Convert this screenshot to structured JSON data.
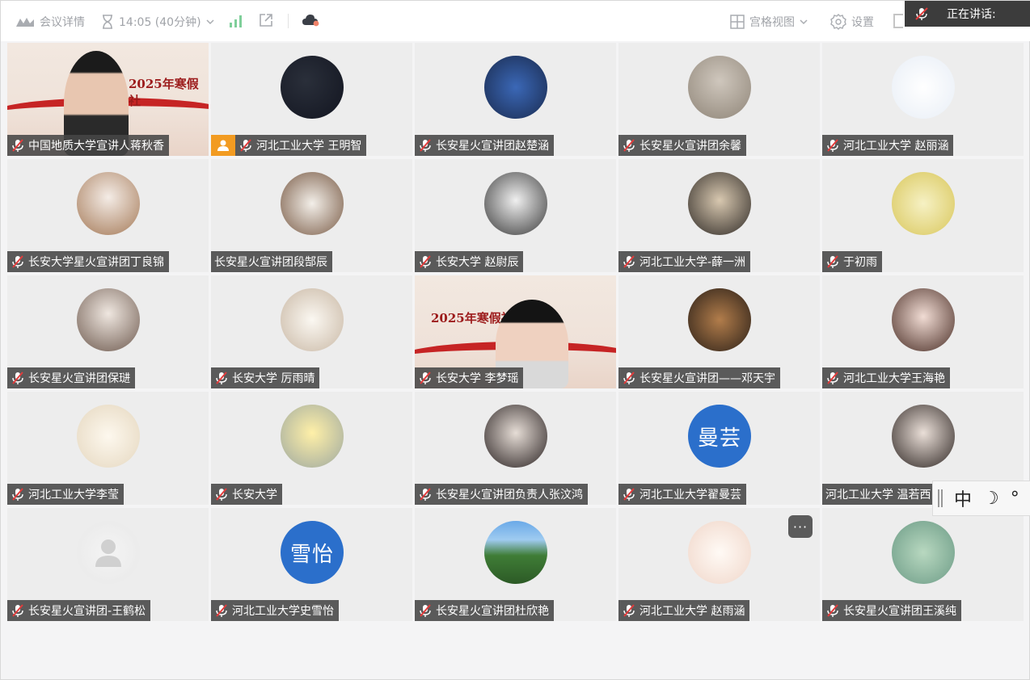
{
  "topbar": {
    "meeting_info": "会议详情",
    "timer": "14:05 (40分钟)",
    "grid_view": "宫格视图",
    "settings": "设置",
    "speaking_label": "正在讲话:",
    "icons": [
      "meeting-logo-icon",
      "hourglass-icon",
      "chevron-down-icon",
      "signal-icon",
      "share-out-icon",
      "cloud-icon",
      "grid-icon",
      "gear-icon",
      "muted-mic-icon"
    ]
  },
  "colors": {
    "label_bg": "#464646",
    "tile_bg": "#ededed",
    "host_badge": "#f29b21",
    "text_avatar": "#2b6fcb",
    "muted_mic_red": "#e23b3b"
  },
  "participants": [
    {
      "name": "中国地质大学宣讲人蒋秋香",
      "video": true,
      "muted": true
    },
    {
      "name": "河北工业大学 王明智",
      "muted": true,
      "host": true
    },
    {
      "name": "长安星火宣讲团赵楚涵",
      "muted": true
    },
    {
      "name": "长安星火宣讲团余馨",
      "muted": true
    },
    {
      "name": "河北工业大学 赵丽涵",
      "muted": true
    },
    {
      "name": "长安大学星火宣讲团丁良锦",
      "muted": true
    },
    {
      "name": "长安星火宣讲团段郜辰",
      "muted": false
    },
    {
      "name": "长安大学 赵尉辰",
      "muted": true
    },
    {
      "name": "河北工业大学-薛一洲",
      "muted": true
    },
    {
      "name": "于初雨",
      "muted": true
    },
    {
      "name": "长安星火宣讲团保琎",
      "muted": true
    },
    {
      "name": "长安大学 厉雨晴",
      "muted": true
    },
    {
      "name": "长安大学 李梦瑶",
      "video": true,
      "muted": true
    },
    {
      "name": "长安星火宣讲团——邓天宇",
      "muted": true
    },
    {
      "name": "河北工业大学王海艳",
      "muted": true
    },
    {
      "name": "河北工业大学李莹",
      "muted": true
    },
    {
      "name": "长安大学",
      "muted": true
    },
    {
      "name": "长安星火宣讲团负责人张汶鸿",
      "muted": true
    },
    {
      "name": "河北工业大学翟曼芸",
      "muted": true,
      "avatar_text": "曼芸"
    },
    {
      "name": "河北工业大学 温若西",
      "muted": false
    },
    {
      "name": "长安星火宣讲团-王鹤松",
      "muted": true
    },
    {
      "name": "河北工业大学史雪怡",
      "muted": true,
      "avatar_text": "雪怡"
    },
    {
      "name": "长安星火宣讲团杜欣艳",
      "muted": true
    },
    {
      "name": "河北工业大学 赵雨涵",
      "muted": true
    },
    {
      "name": "长安星火宣讲团王溪纯",
      "muted": true
    }
  ],
  "video_banners": {
    "tile0": "2025年寒假社",
    "tile12": "2025年寒假社"
  },
  "ime": {
    "mode": "中",
    "moon": "☽",
    "punct": "°"
  },
  "more_button": "···"
}
